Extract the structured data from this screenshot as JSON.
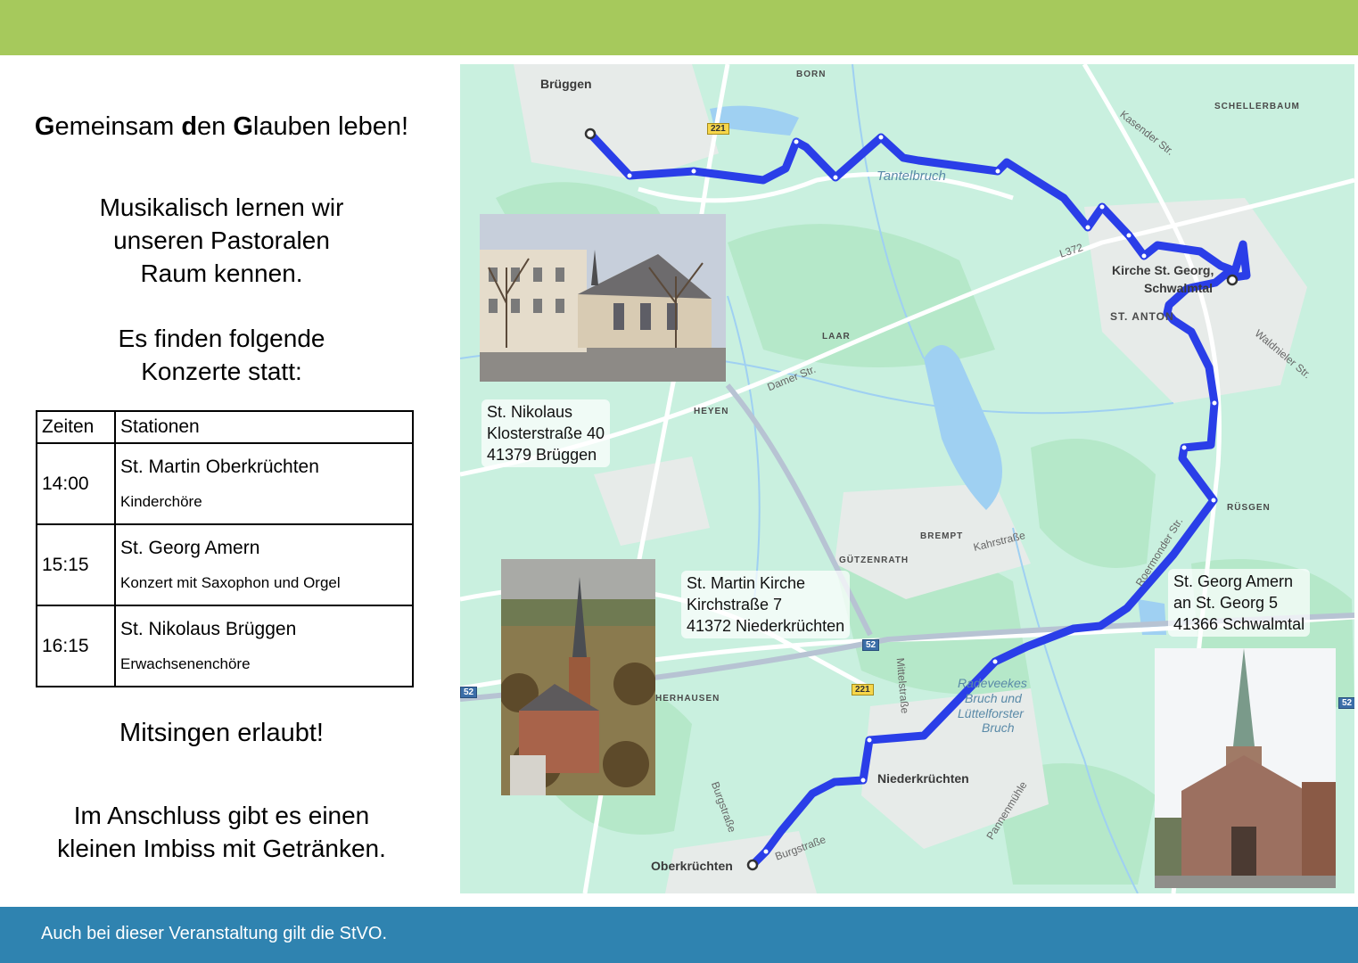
{
  "headline": {
    "g1": "G",
    "t1": "emeinsam ",
    "d": "d",
    "t2": "en ",
    "g2": "G",
    "t3": "lauben leben!"
  },
  "intro": {
    "line1": "Musikalisch lernen wir",
    "line2": "unseren Pastoralen",
    "line3": "Raum kennen."
  },
  "concerts_intro": {
    "line1": "Es finden folgende",
    "line2": "Konzerte statt:"
  },
  "schedule": {
    "header_time": "Zeiten",
    "header_station": "Stationen",
    "rows": [
      {
        "time": "14:00",
        "station": "St. Martin Oberkrüchten",
        "detail": "Kinderchöre"
      },
      {
        "time": "15:15",
        "station": "St. Georg Amern",
        "detail": "Konzert mit Saxophon und Orgel"
      },
      {
        "time": "16:15",
        "station": "St. Nikolaus Brüggen",
        "detail": "Erwachsenenchöre"
      }
    ]
  },
  "sing_along": "Mitsingen erlaubt!",
  "snack": {
    "line1": "Im Anschluss gibt es einen",
    "line2": "kleinen Imbiss mit Getränken."
  },
  "footer": "Auch bei dieser Veranstaltung gilt die StVO.",
  "map": {
    "labels": {
      "brueggen": "Brüggen",
      "born": "BORN",
      "schellerbaum": "SCHELLERBAUM",
      "kasender": "Kasender Str.",
      "tantelbruch": "Tantelbruch",
      "l372": "L372",
      "kirche_st_georg_1": "Kirche St. Georg,",
      "kirche_st_georg_2": "Schwalmtal",
      "st_anton": "ST. ANTON",
      "waldnieler": "Waldnieler Str.",
      "laar": "LAAR",
      "damer": "Damer Str.",
      "heyen": "HEYEN",
      "ruesgen": "RÜSGEN",
      "brempt": "BREMPT",
      "kahrstrasse": "Kahrstraße",
      "guetzenrath": "GÜTZENRATH",
      "roermonder": "Roermonder Str.",
      "herhausen": "HERHAUSEN",
      "mittelstrasse": "Mittelstraße",
      "radeveekes_1": "Radeveekes",
      "radeveekes_2": "Bruch und",
      "radeveekes_3": "Lüttelforster",
      "radeveekes_4": "Bruch",
      "niederkruechten": "Niederkrüchten",
      "burgstrasse": "Burgstraße",
      "burgstrasse2": "Burgstraße",
      "pannenmuehle": "Pannenmühle",
      "oberkruechten": "Oberkrüchten",
      "road_221": "221",
      "road_221b": "221",
      "road_52": "52",
      "road_52b": "52",
      "road_52c": "52"
    },
    "route_color": "#2a3ee8",
    "water_color": "#9fd0f2",
    "addresses": {
      "nikolaus": {
        "l1": "St. Nikolaus",
        "l2": "Klosterstraße 40",
        "l3": "41379 Brüggen"
      },
      "martin": {
        "l1": "St. Martin Kirche",
        "l2": "Kirchstraße 7",
        "l3": "41372 Niederkrüchten"
      },
      "georg": {
        "l1": "St. Georg Amern",
        "l2": "an St. Georg 5",
        "l3": "41366 Schwalmtal"
      }
    }
  }
}
